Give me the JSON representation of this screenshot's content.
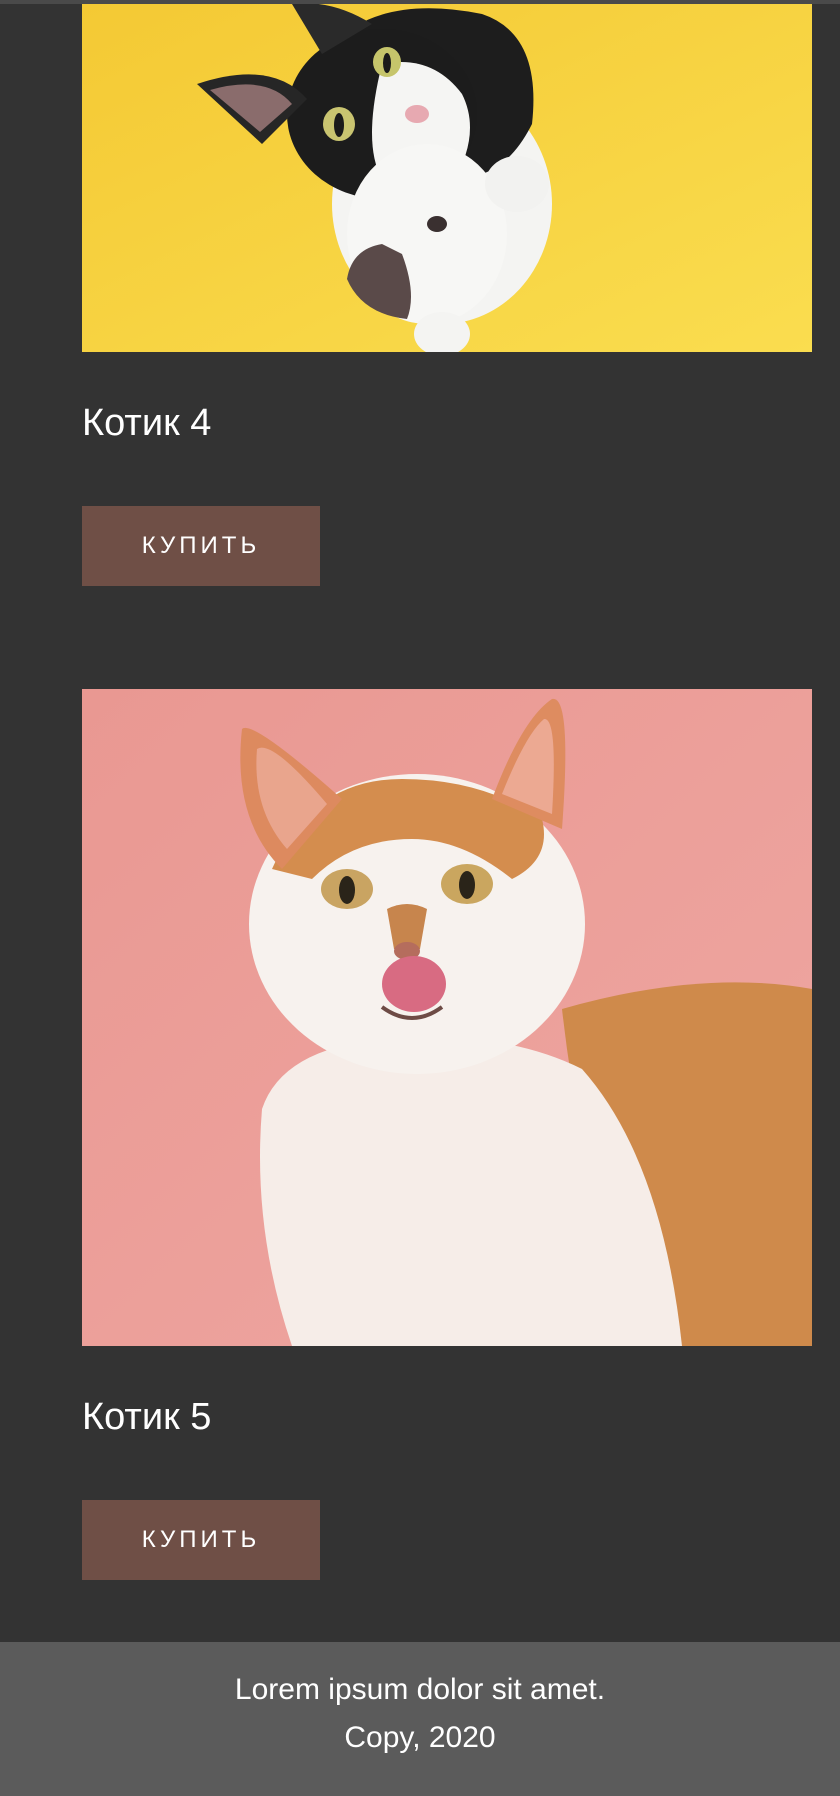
{
  "products": [
    {
      "title": "Котик 4",
      "button_label": "КУПИТЬ",
      "photo_background": "#f7d23b"
    },
    {
      "title": "Котик 5",
      "button_label": "КУПИТЬ",
      "photo_background": "#eb9d98"
    }
  ],
  "footer": {
    "line1": "Lorem ipsum dolor sit amet.",
    "line2": "Copy, 2020"
  },
  "colors": {
    "page_background": "#333333",
    "button_background": "#6f4f46",
    "footer_background": "#5b5b5b",
    "text": "#ffffff"
  }
}
